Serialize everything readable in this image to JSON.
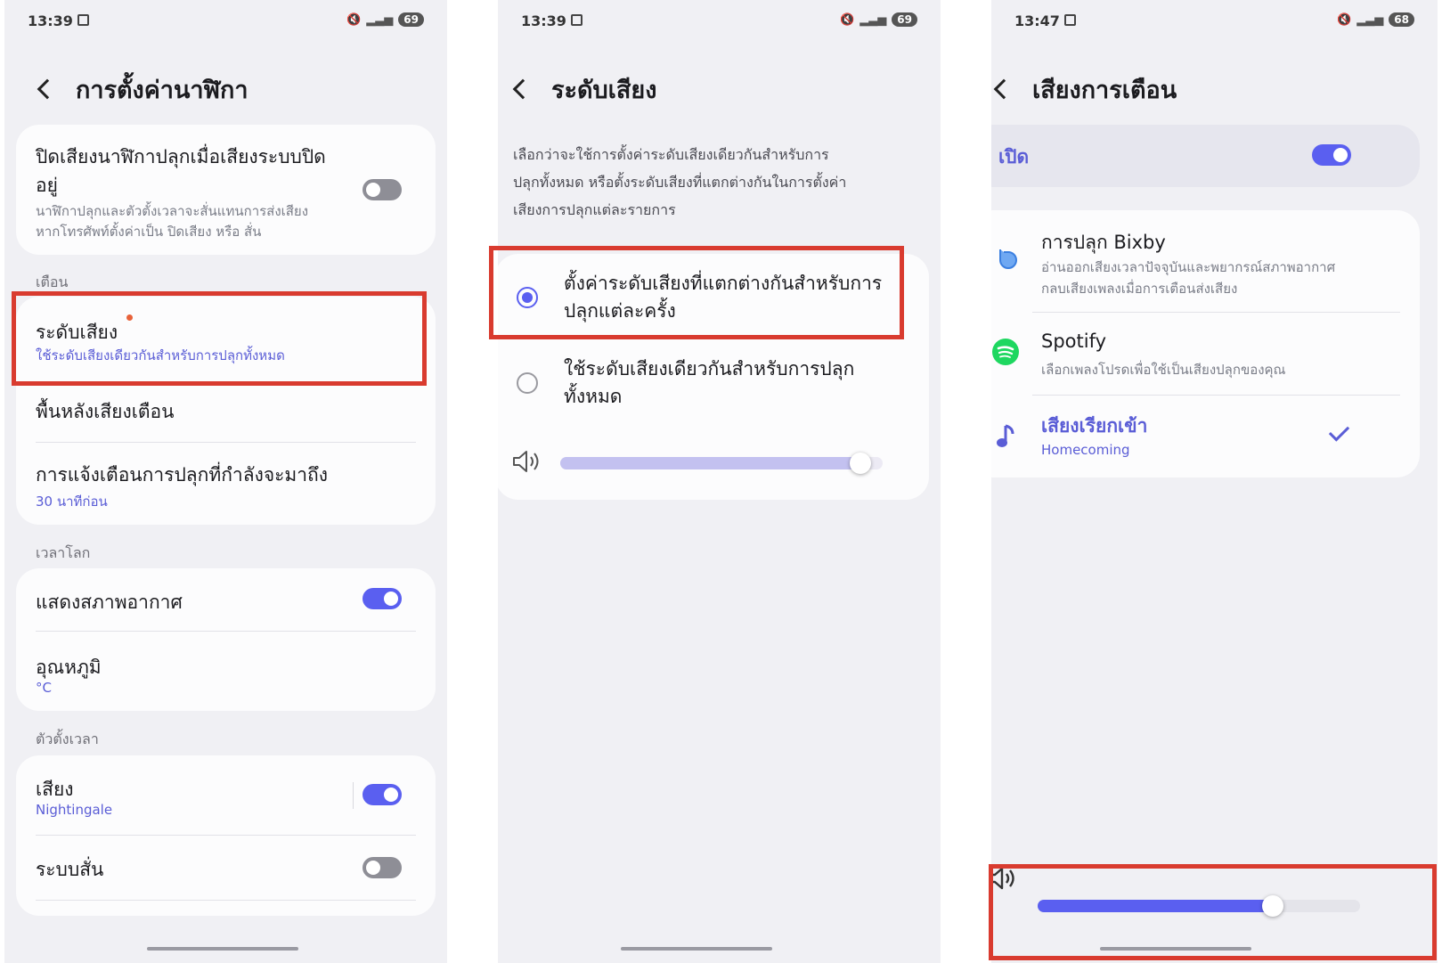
{
  "panels": [
    {
      "status": {
        "time": "13:39",
        "battery": "69"
      },
      "title": "การตั้งค่านาฬิกา",
      "silent_setting": {
        "title_line1": "ปิดเสียงนาฬิกาปลุกเมื่อเสียงระบบปิด",
        "title_line2": "อยู่",
        "sub_line1": "นาฬิกาปลุกและตัวตั้งเวลาจะสั่นแทนการส่งเสียง",
        "sub_line2": "หากโทรศัพท์ตั้งค่าเป็น ปิดเสียง หรือ สั่น",
        "enabled": false
      },
      "section_alarm": "เตือน",
      "volume": {
        "title": "ระดับเสียง",
        "sub": "ใช้ระดับเสียงเดียวกันสำหรับการปลุกทั้งหมด"
      },
      "background_sound": "พื้นหลังเสียงเตือน",
      "upcoming": {
        "title": "การแจ้งเตือนการปลุกที่กำลังจะมาถึง",
        "sub": "30 นาทีก่อน"
      },
      "section_world": "เวลาโลก",
      "weather": {
        "title": "แสดงสภาพอากาศ",
        "enabled": true
      },
      "temperature": {
        "title": "อุณหภูมิ",
        "sub": "°C"
      },
      "section_timer": "ตัวตั้งเวลา",
      "timer_sound": {
        "title": "เสียง",
        "sub": "Nightingale",
        "enabled": true
      },
      "vibration": {
        "title": "ระบบสั่น",
        "enabled": false
      }
    },
    {
      "status": {
        "time": "13:39",
        "battery": "69"
      },
      "title": "ระดับเสียง",
      "desc_line1": "เลือกว่าจะใช้การตั้งค่าระดับเสียงเดียวกันสำหรับการ",
      "desc_line2": "ปลุกทั้งหมด หรือตั้งระดับเสียงที่แตกต่างกันในการตั้งค่า",
      "desc_line3": "เสียงการปลุกแต่ละรายการ",
      "option1_line1": "ตั้งค่าระดับเสียงที่แตกต่างกันสำหรับการ",
      "option1_line2": "ปลุกแต่ละครั้ง",
      "option2_line1": "ใช้ระดับเสียงเดียวกันสำหรับการปลุก",
      "option2_line2": "ทั้งหมด",
      "selected_option": 1,
      "volume_level": 0.93
    },
    {
      "status": {
        "time": "13:47",
        "battery": "68"
      },
      "title": "เสียงการเตือน",
      "master_label": "เปิด",
      "master_enabled": true,
      "bixby": {
        "title": "การปลุก Bixby",
        "sub_line1": "อ่านออกเสียงเวลาปัจจุบันและพยากรณ์สภาพอากาศ",
        "sub_line2": "กลบเสียงเพลงเมื่อการเตือนส่งเสียง"
      },
      "spotify": {
        "title": "Spotify",
        "sub": "เลือกเพลงโปรดเพื่อใช้เป็นเสียงปลุกของคุณ"
      },
      "ringtone": {
        "title": "เสียงเรียกเข้า",
        "sub": "Homecoming",
        "selected": true
      },
      "volume_level": 0.73
    }
  ],
  "colors": {
    "accent": "#5a5ff0",
    "highlight_box": "#d93b2f",
    "spotify": "#1ed760",
    "bixby": "#3b7fe0"
  },
  "icons": [
    "back-icon",
    "speaker-icon",
    "bixby-icon",
    "spotify-icon",
    "music-note-icon",
    "check-icon"
  ]
}
